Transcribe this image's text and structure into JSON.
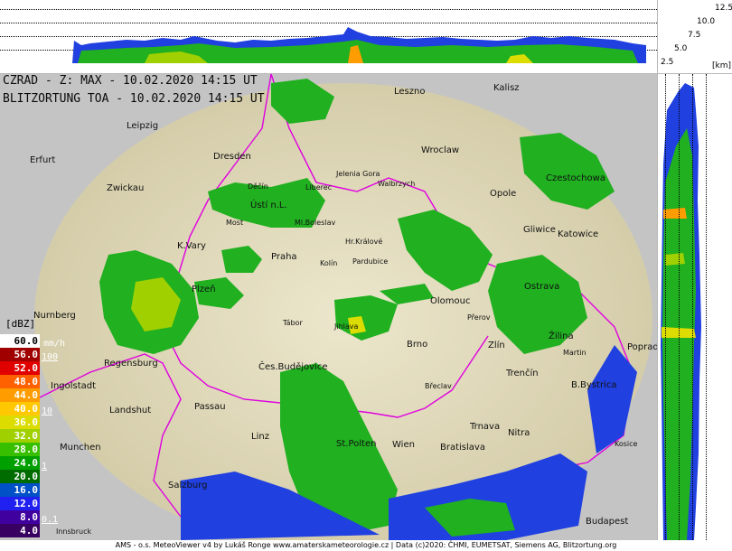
{
  "title_line1": "CZRAD - Z: MAX - 10.02.2020 14:15 UT",
  "title_line2": "BLITZORTUNG TOA - 10.02.2020 14:15 UT",
  "height_scale": {
    "unit": "[km]",
    "labels": [
      "12.5",
      "10.0",
      "7.5",
      "5.0",
      "2.5"
    ]
  },
  "legend": {
    "unit": "[dBZ]",
    "rate_unit": "mm/h",
    "dbz": [
      {
        "value": "60.0",
        "color": "#ffffff",
        "text_color": "#000000"
      },
      {
        "value": "56.0",
        "color": "#a00000",
        "text_color": "#ffffff"
      },
      {
        "value": "52.0",
        "color": "#e00000",
        "text_color": "#ffffff"
      },
      {
        "value": "48.0",
        "color": "#ff6000",
        "text_color": "#ffffff"
      },
      {
        "value": "44.0",
        "color": "#ff9c00",
        "text_color": "#ffffff"
      },
      {
        "value": "40.0",
        "color": "#ffc800",
        "text_color": "#ffffff"
      },
      {
        "value": "36.0",
        "color": "#dcdc00",
        "text_color": "#ffffff"
      },
      {
        "value": "32.0",
        "color": "#a0d000",
        "text_color": "#ffffff"
      },
      {
        "value": "28.0",
        "color": "#38c000",
        "text_color": "#ffffff"
      },
      {
        "value": "24.0",
        "color": "#00a000",
        "text_color": "#ffffff"
      },
      {
        "value": "20.0",
        "color": "#006c00",
        "text_color": "#ffffff"
      },
      {
        "value": "16.0",
        "color": "#0050c8",
        "text_color": "#ffffff"
      },
      {
        "value": "12.0",
        "color": "#2020f0",
        "text_color": "#ffffff"
      },
      {
        "value": "8.0",
        "color": "#4000a0",
        "text_color": "#ffffff"
      },
      {
        "value": "4.0",
        "color": "#380060",
        "text_color": "#ffffff"
      }
    ],
    "rates": [
      "100",
      "10",
      "1",
      "0.1"
    ]
  },
  "cities": [
    "Leszno",
    "Kalisz",
    "Leipzig",
    "Wroclaw",
    "Erfurt",
    "Dresden",
    "Jelenia Gora",
    "Walbrzych",
    "Opole",
    "Czestochowa",
    "Zwickau",
    "Děčín",
    "Liberec",
    "Ústí n.L.",
    "Ml.Boleslav",
    "Most",
    "Gliwice",
    "Katowice",
    "K.Vary",
    "Hr.Králové",
    "Praha",
    "Kolín",
    "Pardubice",
    "Plzeň",
    "Ostrava",
    "Olomouc",
    "Nurnberg",
    "Tábor",
    "Jihlava",
    "Přerov",
    "Zlín",
    "Brno",
    "Žilina",
    "Regensburg",
    "Poprad",
    "Martin",
    "Čes.Budějovice",
    "Trenčín",
    "Ingolstadt",
    "Břeclav",
    "B.Bystrica",
    "Passau",
    "Landshut",
    "Trnava",
    "Nitra",
    "Linz",
    "Munchen",
    "St.Polten",
    "Wien",
    "Bratislava",
    "Salzburg",
    "Budapest",
    "Innsbruck",
    "Kosice"
  ],
  "footer": "AMS - o.s. MeteoViewer v4 by Lukáš Ronge www.amaterskameteorologie.cz | Data (c)2020: ČHMI, EUMETSAT, Siemens AG, Blitzortung.org",
  "colors": {
    "background": "#c4c4c4",
    "map_land": "#e2dcbf",
    "border": "#e000e0",
    "echo_green": "#20b020",
    "echo_blue": "#2040e0"
  }
}
